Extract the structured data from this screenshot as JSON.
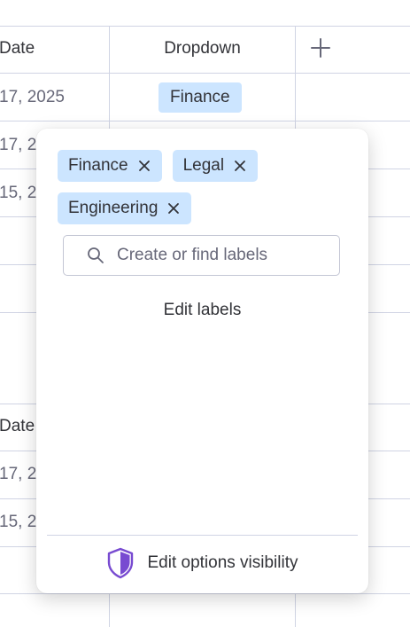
{
  "board": {
    "header_date_label": "Date",
    "header_dropdown_label": "Dropdown",
    "rows": [
      {
        "date": "17, 2025",
        "tag": "Finance"
      },
      {
        "date": "17, 2"
      },
      {
        "date": "15, 2"
      }
    ],
    "group2_header_date_label": "Date",
    "group2_rows": [
      {
        "date": "17, 2"
      },
      {
        "date": "15, 2"
      }
    ]
  },
  "popup": {
    "selected_labels": [
      "Finance",
      "Legal",
      "Engineering"
    ],
    "search": {
      "placeholder": "Create or find labels",
      "value": ""
    },
    "edit_labels_text": "Edit labels",
    "footer_text": "Edit options visibility"
  },
  "colors": {
    "chip_bg": "#cce5ff",
    "grid_line": "#d0d4e4",
    "text": "#323338",
    "shield_purple": "#784bd1"
  },
  "icons": {
    "add_column": "plus-icon",
    "chip_remove": "close-icon",
    "search": "search-icon",
    "footer": "shield-icon"
  }
}
